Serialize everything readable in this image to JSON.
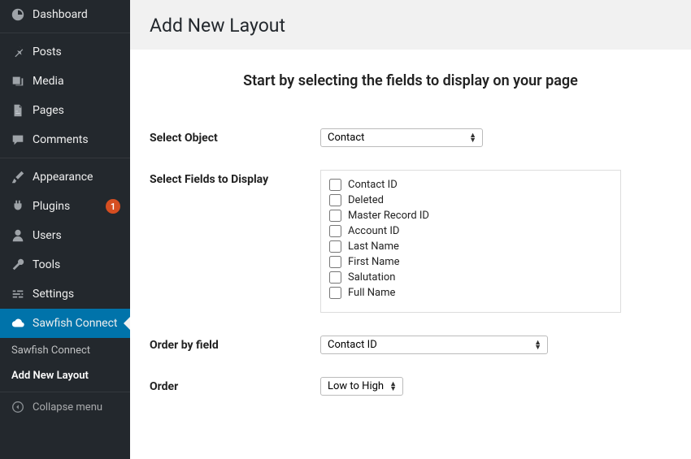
{
  "sidebar": {
    "items": [
      {
        "label": "Dashboard",
        "icon": "dashboard"
      },
      {
        "label": "Posts",
        "icon": "pin"
      },
      {
        "label": "Media",
        "icon": "media"
      },
      {
        "label": "Pages",
        "icon": "pages"
      },
      {
        "label": "Comments",
        "icon": "comment"
      },
      {
        "label": "Appearance",
        "icon": "brush"
      },
      {
        "label": "Plugins",
        "icon": "plug",
        "badge": "1"
      },
      {
        "label": "Users",
        "icon": "user"
      },
      {
        "label": "Tools",
        "icon": "wrench"
      },
      {
        "label": "Settings",
        "icon": "sliders"
      },
      {
        "label": "Sawfish Connect",
        "icon": "cloud",
        "active": true
      }
    ],
    "subitems": [
      {
        "label": "Sawfish Connect"
      },
      {
        "label": "Add New Layout",
        "current": true
      }
    ],
    "collapse": "Collapse menu"
  },
  "page": {
    "title": "Add New Layout",
    "intro": "Start by selecting the fields to display on your page",
    "labels": {
      "select_object": "Select Object",
      "select_fields": "Select Fields to Display",
      "order_by": "Order by field",
      "order": "Order"
    },
    "select_object_value": "Contact",
    "order_by_value": "Contact ID",
    "order_value": "Low to High",
    "fields": [
      "Contact ID",
      "Deleted",
      "Master Record ID",
      "Account ID",
      "Last Name",
      "First Name",
      "Salutation",
      "Full Name"
    ]
  }
}
